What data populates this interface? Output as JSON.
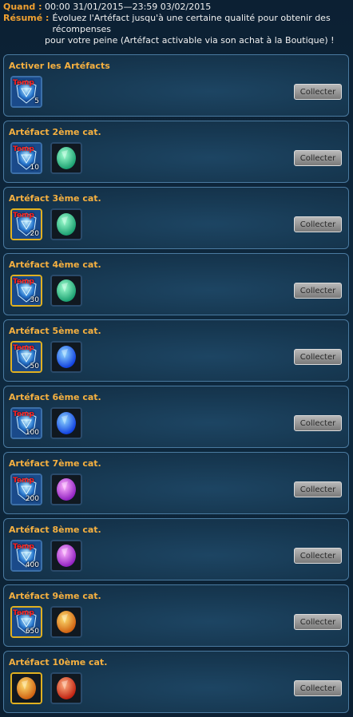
{
  "header": {
    "when_label": "Quand :",
    "when_value": "00:00 31/01/2015—23:59 03/02/2015",
    "summary_label": "Résumé :",
    "summary_line1": "Évoluez l'Artéfact jusqu'à une certaine qualité pour obtenir des récompenses",
    "summary_line2": "pour votre peine (Artéfact activable via son achat à la Boutique) !"
  },
  "colors": {
    "title": "#f5b040",
    "header_label": "#f0a030",
    "temp_tag": "#ff2020"
  },
  "cards": [
    {
      "title": "Activer les Artéfacts",
      "button": "Collecter",
      "rewards": [
        {
          "icon": "artifact-icon",
          "tag": "Temp",
          "qty": "5",
          "frame": "blue"
        }
      ]
    },
    {
      "title": "Artéfact 2ème cat.",
      "button": "Collecter",
      "rewards": [
        {
          "icon": "artifact-icon",
          "tag": "Temp",
          "qty": "10",
          "frame": "blue"
        },
        {
          "icon": "green-crystal-icon",
          "tag": "",
          "qty": "",
          "frame": "plain"
        }
      ]
    },
    {
      "title": "Artéfact 3ème cat.",
      "button": "Collecter",
      "rewards": [
        {
          "icon": "artifact-icon",
          "tag": "Temp",
          "qty": "20",
          "frame": "gold"
        },
        {
          "icon": "green-crystal-icon",
          "tag": "",
          "qty": "",
          "frame": "plain"
        }
      ]
    },
    {
      "title": "Artéfact 4ème cat.",
      "button": "Collecter",
      "rewards": [
        {
          "icon": "artifact-icon",
          "tag": "Temp",
          "qty": "30",
          "frame": "gold"
        },
        {
          "icon": "green-crystal-icon",
          "tag": "",
          "qty": "",
          "frame": "plain"
        }
      ]
    },
    {
      "title": "Artéfact 5ème cat.",
      "button": "Collecter",
      "rewards": [
        {
          "icon": "artifact-icon",
          "tag": "Temp",
          "qty": "50",
          "frame": "gold"
        },
        {
          "icon": "blue-crystal-icon",
          "tag": "",
          "qty": "",
          "frame": "plain"
        }
      ]
    },
    {
      "title": "Artéfact 6ème cat.",
      "button": "Collecter",
      "rewards": [
        {
          "icon": "artifact-icon",
          "tag": "Temp",
          "qty": "100",
          "frame": "blue"
        },
        {
          "icon": "blue-crystal-icon",
          "tag": "",
          "qty": "",
          "frame": "plain"
        }
      ]
    },
    {
      "title": "Artéfact 7ème cat.",
      "button": "Collecter",
      "rewards": [
        {
          "icon": "artifact-icon",
          "tag": "Temp",
          "qty": "200",
          "frame": "blue"
        },
        {
          "icon": "purple-crystal-icon",
          "tag": "",
          "qty": "",
          "frame": "plain"
        }
      ]
    },
    {
      "title": "Artéfact 8ème cat.",
      "button": "Collecter",
      "rewards": [
        {
          "icon": "artifact-icon",
          "tag": "Temp",
          "qty": "400",
          "frame": "blue"
        },
        {
          "icon": "purple-crystal-icon",
          "tag": "",
          "qty": "",
          "frame": "plain"
        }
      ]
    },
    {
      "title": "Artéfact 9ème cat.",
      "button": "Collecter",
      "rewards": [
        {
          "icon": "artifact-icon",
          "tag": "Temp",
          "qty": "650",
          "frame": "gold"
        },
        {
          "icon": "orange-crystal-icon",
          "tag": "",
          "qty": "",
          "frame": "plain"
        }
      ]
    },
    {
      "title": "Artéfact 10ème cat.",
      "button": "Collecter",
      "rewards": [
        {
          "icon": "orange-crystal-icon",
          "tag": "",
          "qty": "",
          "frame": "gold"
        },
        {
          "icon": "red-crystal-icon",
          "tag": "",
          "qty": "",
          "frame": "plain"
        }
      ]
    }
  ],
  "crystal_colors": {
    "green-crystal-icon": [
      "#9fffd0",
      "#1aa070"
    ],
    "blue-crystal-icon": [
      "#8fd8ff",
      "#1040e0"
    ],
    "purple-crystal-icon": [
      "#ffb0ff",
      "#9020c0"
    ],
    "orange-crystal-icon": [
      "#ffe070",
      "#d06010"
    ],
    "red-crystal-icon": [
      "#ffb080",
      "#c02010"
    ]
  }
}
